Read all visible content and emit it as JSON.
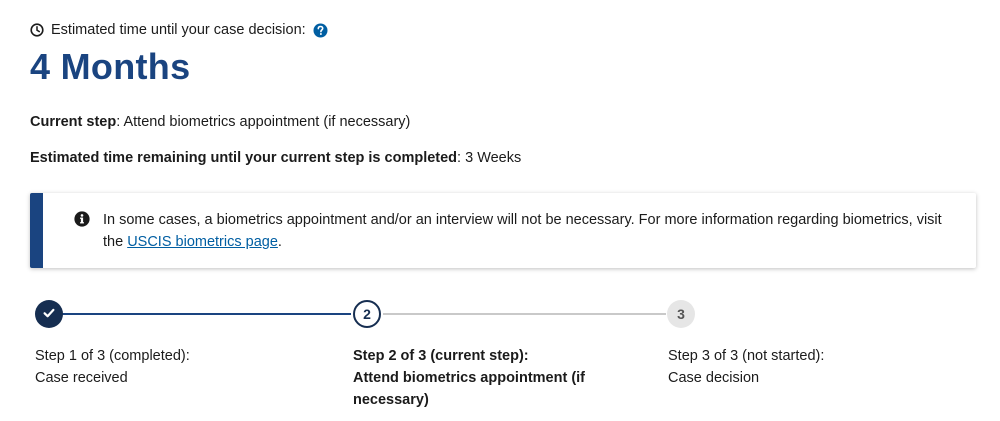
{
  "estimate": {
    "label": "Estimated time until your case decision:",
    "value": "4 Months",
    "icons": {
      "clock": "clock-icon",
      "help": "question-circle-icon"
    }
  },
  "current_step": {
    "label": "Current step",
    "value": ": Attend biometrics appointment (if necessary)"
  },
  "remaining": {
    "label": "Estimated time remaining until your current step is completed",
    "value": ": 3 Weeks"
  },
  "alert": {
    "icon": "info-circle-icon",
    "text_before": "In some cases, a biometrics appointment and/or an interview will not be necessary. For more information regarding biometrics, visit the ",
    "link_text": "USCIS biometrics page",
    "text_after": "."
  },
  "steps": [
    {
      "marker": "",
      "status_line": "Step 1 of 3 (completed):",
      "name": "Case received",
      "state": "completed"
    },
    {
      "marker": "2",
      "status_line": "Step 2 of 3 (current step):",
      "name": "Attend biometrics appointment (if necessary)",
      "state": "current"
    },
    {
      "marker": "3",
      "status_line": "Step 3 of 3 (not started):",
      "name": "Case decision",
      "state": "not-started"
    }
  ],
  "colors": {
    "primary_dark": "#1a4480",
    "step_dark": "#162e51",
    "link": "#005ea2",
    "inactive_line": "#c9c9c9",
    "inactive_circle": "#e6e6e6"
  }
}
